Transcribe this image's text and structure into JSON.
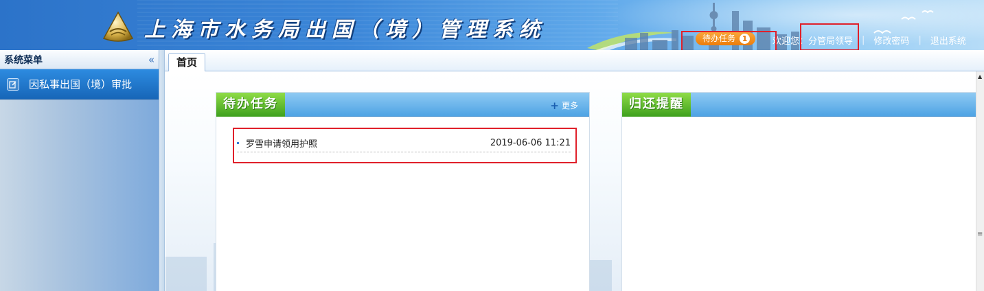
{
  "header": {
    "app_title": "上海市水务局出国（境）管理系统",
    "todo_label": "待办任务",
    "todo_count": "1",
    "welcome_label": "欢迎您：",
    "user_name": "分管局领导",
    "change_password": "修改密码",
    "logout": "退出系统",
    "separator": "|"
  },
  "sidebar": {
    "title": "系统菜单",
    "collapse_glyph": "«",
    "items": [
      {
        "label": "因私事出国（境）审批"
      }
    ]
  },
  "tabs": [
    {
      "label": "首页"
    }
  ],
  "panels": {
    "todo": {
      "title": "待办任务",
      "more": "更多",
      "items": [
        {
          "title": "罗雪申请领用护照",
          "time": "2019-06-06 11:21"
        }
      ]
    },
    "return_reminder": {
      "title": "归还提醒"
    }
  },
  "colors": {
    "header_blue": "#2c73c9",
    "badge_orange": "#ec7d0c",
    "panel_green": "#3ea01d",
    "highlight_red": "#e0202a"
  },
  "icons": [
    "logo-emblem-icon",
    "edit-icon",
    "plus-icon",
    "scroll-up-icon"
  ]
}
